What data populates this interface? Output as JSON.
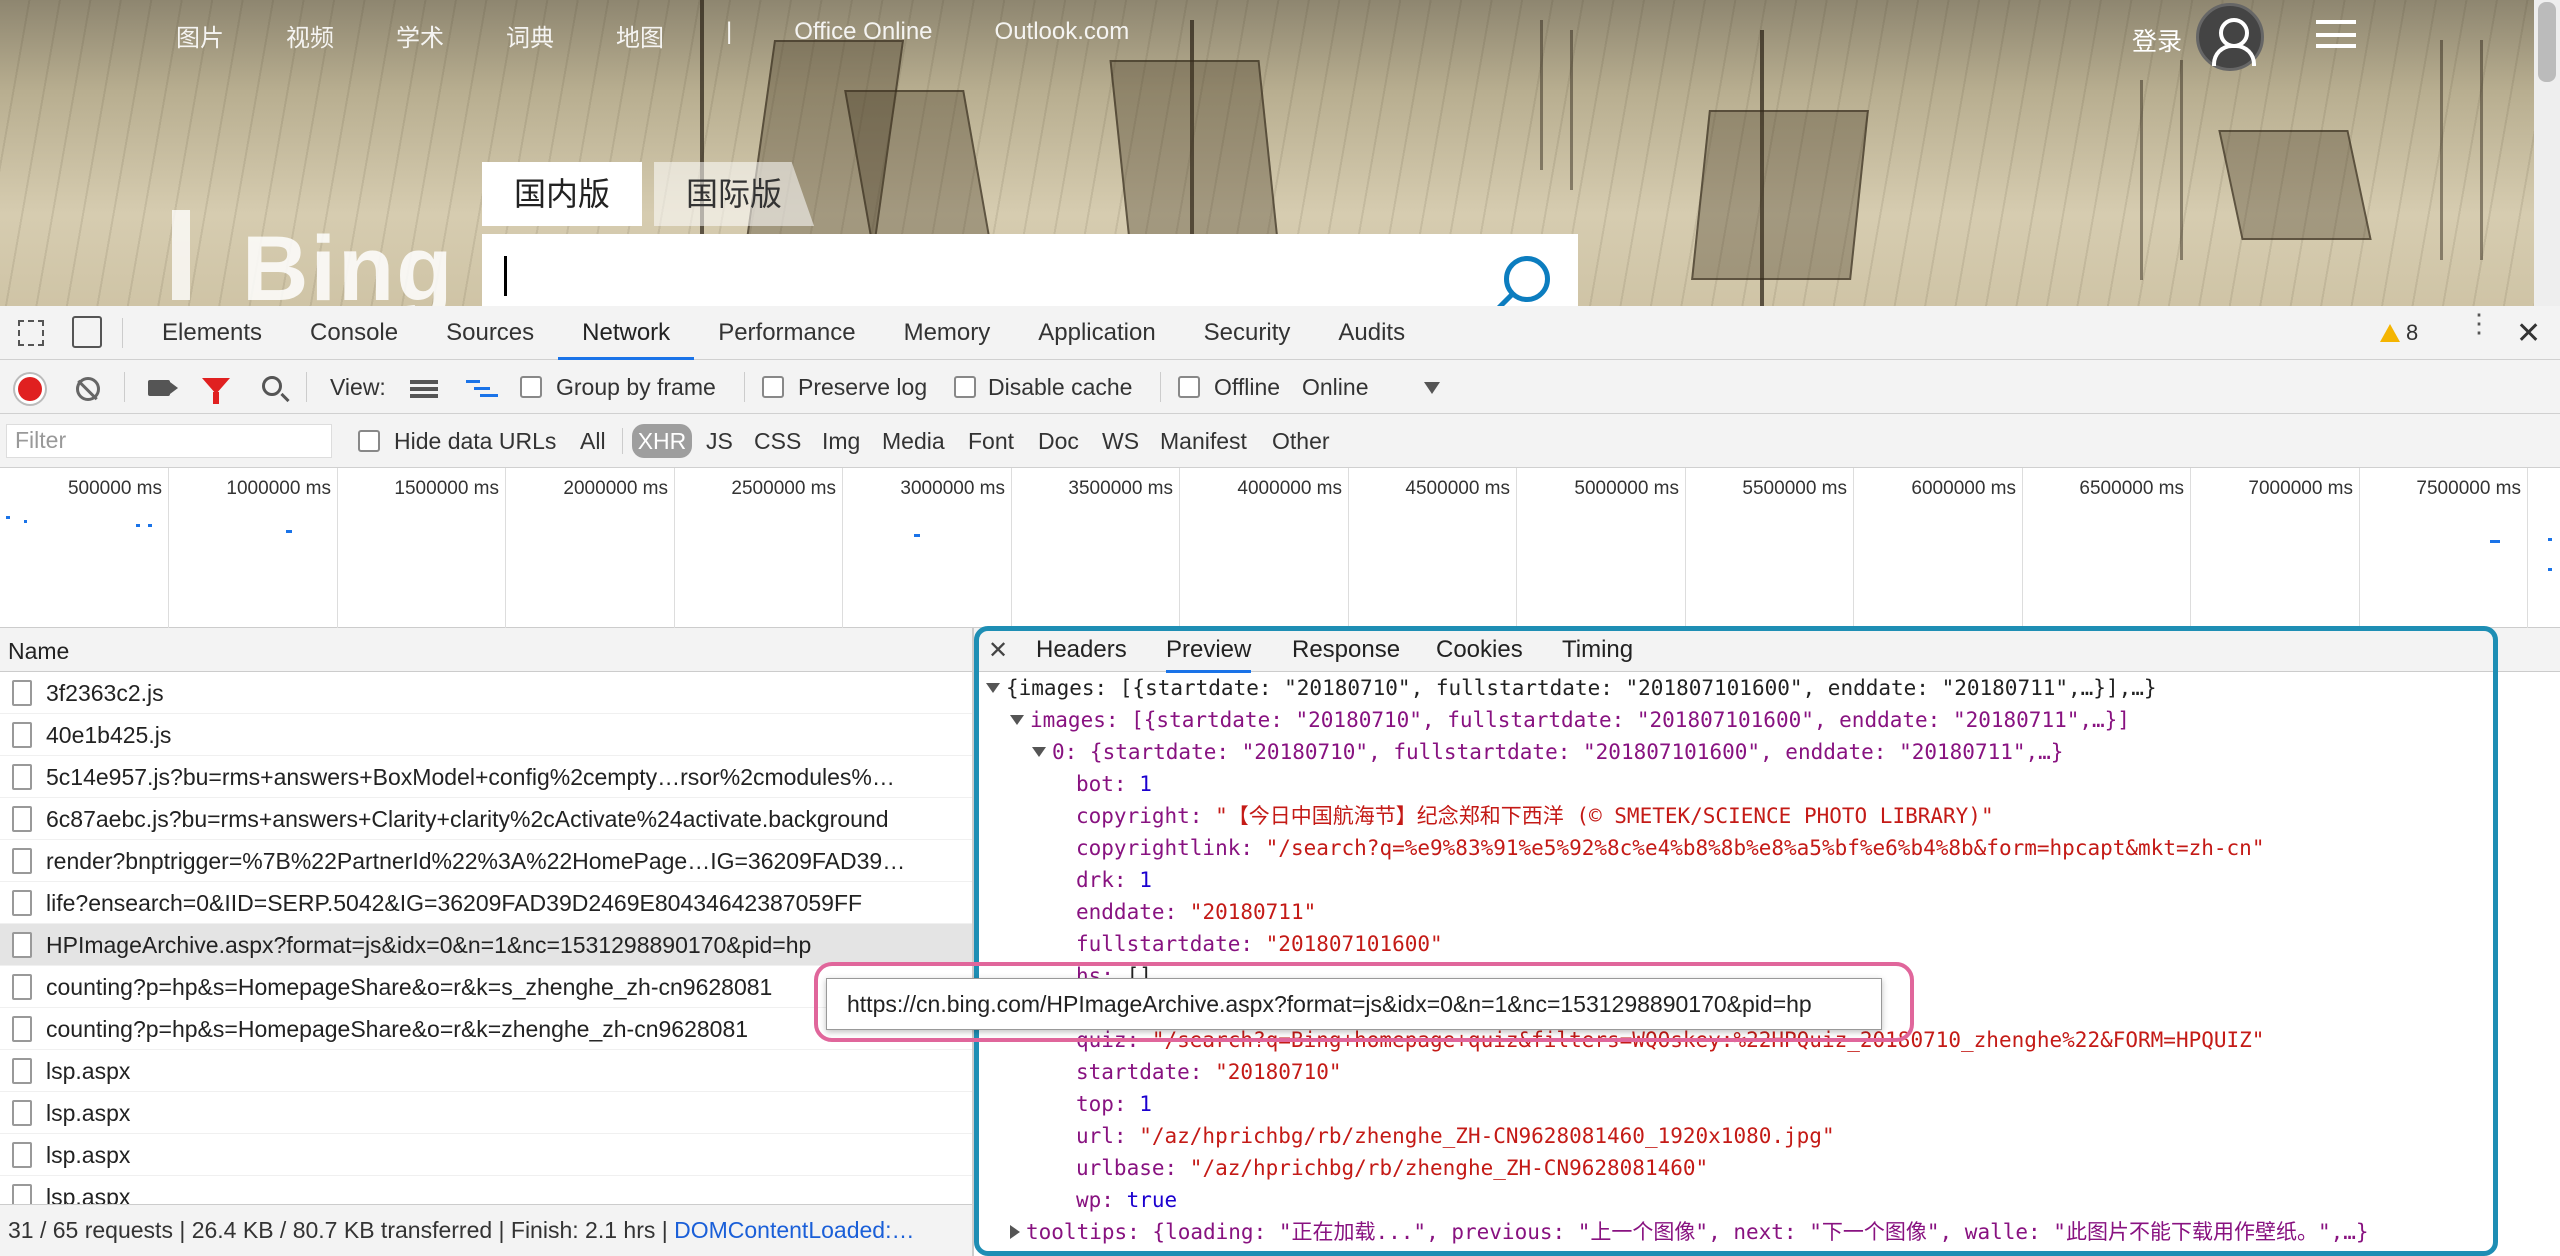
{
  "bing": {
    "nav": [
      "图片",
      "视频",
      "学术",
      "词典",
      "地图",
      "|",
      "Office Online",
      "Outlook.com"
    ],
    "login": "登录",
    "tabs": [
      "国内版",
      "国际版"
    ],
    "logo": "Bing"
  },
  "devtools": {
    "tabs": [
      "Elements",
      "Console",
      "Sources",
      "Network",
      "Performance",
      "Memory",
      "Application",
      "Security",
      "Audits"
    ],
    "active_tab": "Network",
    "warnings": "8",
    "toolbar": {
      "view_label": "View:",
      "group_by_frame": "Group by frame",
      "preserve_log": "Preserve log",
      "disable_cache": "Disable cache",
      "offline": "Offline",
      "throttle": "Online"
    },
    "filter": {
      "placeholder": "Filter",
      "hide_data_urls": "Hide data URLs",
      "types": [
        "All",
        "XHR",
        "JS",
        "CSS",
        "Img",
        "Media",
        "Font",
        "Doc",
        "WS",
        "Manifest",
        "Other"
      ],
      "active_type": "XHR"
    },
    "timeline_ticks": [
      "500000 ms",
      "1000000 ms",
      "1500000 ms",
      "2000000 ms",
      "2500000 ms",
      "3000000 ms",
      "3500000 ms",
      "4000000 ms",
      "4500000 ms",
      "5000000 ms",
      "5500000 ms",
      "6000000 ms",
      "6500000 ms",
      "7000000 ms",
      "7500000 ms"
    ],
    "name_header": "Name",
    "requests": [
      "3f2363c2.js",
      "40e1b425.js",
      "5c14e957.js?bu=rms+answers+BoxModel+config%2cempty…rsor%2cmodules%…",
      "6c87aebc.js?bu=rms+answers+Clarity+clarity%2cActivate%24activate.background",
      "render?bnptrigger=%7B%22PartnerId%22%3A%22HomePage…IG=36209FAD39…",
      "life?ensearch=0&IID=SERP.5042&IG=36209FAD39D2469E80434642387059FF",
      "HPImageArchive.aspx?format=js&idx=0&n=1&nc=1531298890170&pid=hp",
      "counting?p=hp&s=HomepageShare&o=r&k=s_zhenghe_zh-cn9628081",
      "counting?p=hp&s=HomepageShare&o=r&k=zhenghe_zh-cn9628081",
      "lsp.aspx",
      "lsp.aspx",
      "lsp.aspx",
      "lsp.aspx"
    ],
    "selected_request": "HPImageArchive.aspx?format=js&idx=0&n=1&nc=1531298890170&pid=hp",
    "status": "31 / 65 requests | 26.4 KB / 80.7 KB transferred | Finish: 2.1 hrs | ",
    "status_dcl": "DOMContentLoaded:…",
    "detail_tabs": [
      "Headers",
      "Preview",
      "Response",
      "Cookies",
      "Timing"
    ],
    "detail_active": "Preview",
    "tooltip": "https://cn.bing.com/HPImageArchive.aspx?format=js&idx=0&n=1&nc=1531298890170&pid=hp",
    "preview": {
      "root": "{images: [{startdate: \"20180710\", fullstartdate: \"201807101600\", enddate: \"20180711\",…}],…}",
      "images": "images: [{startdate: \"20180710\", fullstartdate: \"201807101600\", enddate: \"20180711\",…}]",
      "item0": "0: {startdate: \"20180710\", fullstartdate: \"201807101600\", enddate: \"20180711\",…}",
      "fields": [
        {
          "k": "bot",
          "v": "1",
          "t": "n"
        },
        {
          "k": "copyright",
          "v": "\"【今日中国航海节】纪念郑和下西洋 (© SMETEK/SCIENCE PHOTO LIBRARY)\"",
          "t": "s"
        },
        {
          "k": "copyrightlink",
          "v": "\"/search?q=%e9%83%91%e5%92%8c%e4%b8%8b%e8%a5%bf%e6%b4%8b&form=hpcapt&mkt=zh-cn\"",
          "t": "s"
        },
        {
          "k": "drk",
          "v": "1",
          "t": "n"
        },
        {
          "k": "enddate",
          "v": "\"20180711\"",
          "t": "s"
        },
        {
          "k": "fullstartdate",
          "v": "\"201807101600\"",
          "t": "s"
        },
        {
          "k": "hs",
          "v": "[]",
          "t": "p"
        },
        {
          "k": "hsh",
          "v": "",
          "t": "p"
        },
        {
          "k": "quiz",
          "v": "\"/search?q=Bing+homepage+quiz&filters=WQOskey:%22HPQuiz_20180710_zhenghe%22&FORM=HPQUIZ\"",
          "t": "s"
        },
        {
          "k": "startdate",
          "v": "\"20180710\"",
          "t": "s"
        },
        {
          "k": "top",
          "v": "1",
          "t": "n"
        },
        {
          "k": "url",
          "v": "\"/az/hprichbg/rb/zhenghe_ZH-CN9628081460_1920x1080.jpg\"",
          "t": "s"
        },
        {
          "k": "urlbase",
          "v": "\"/az/hprichbg/rb/zhenghe_ZH-CN9628081460\"",
          "t": "s"
        },
        {
          "k": "wp",
          "v": "true",
          "t": "n"
        }
      ],
      "tooltips": "tooltips: {loading: \"正在加载...\", previous: \"上一个图像\", next: \"下一个图像\", walle: \"此图片不能下载用作壁纸。\",…}"
    }
  }
}
